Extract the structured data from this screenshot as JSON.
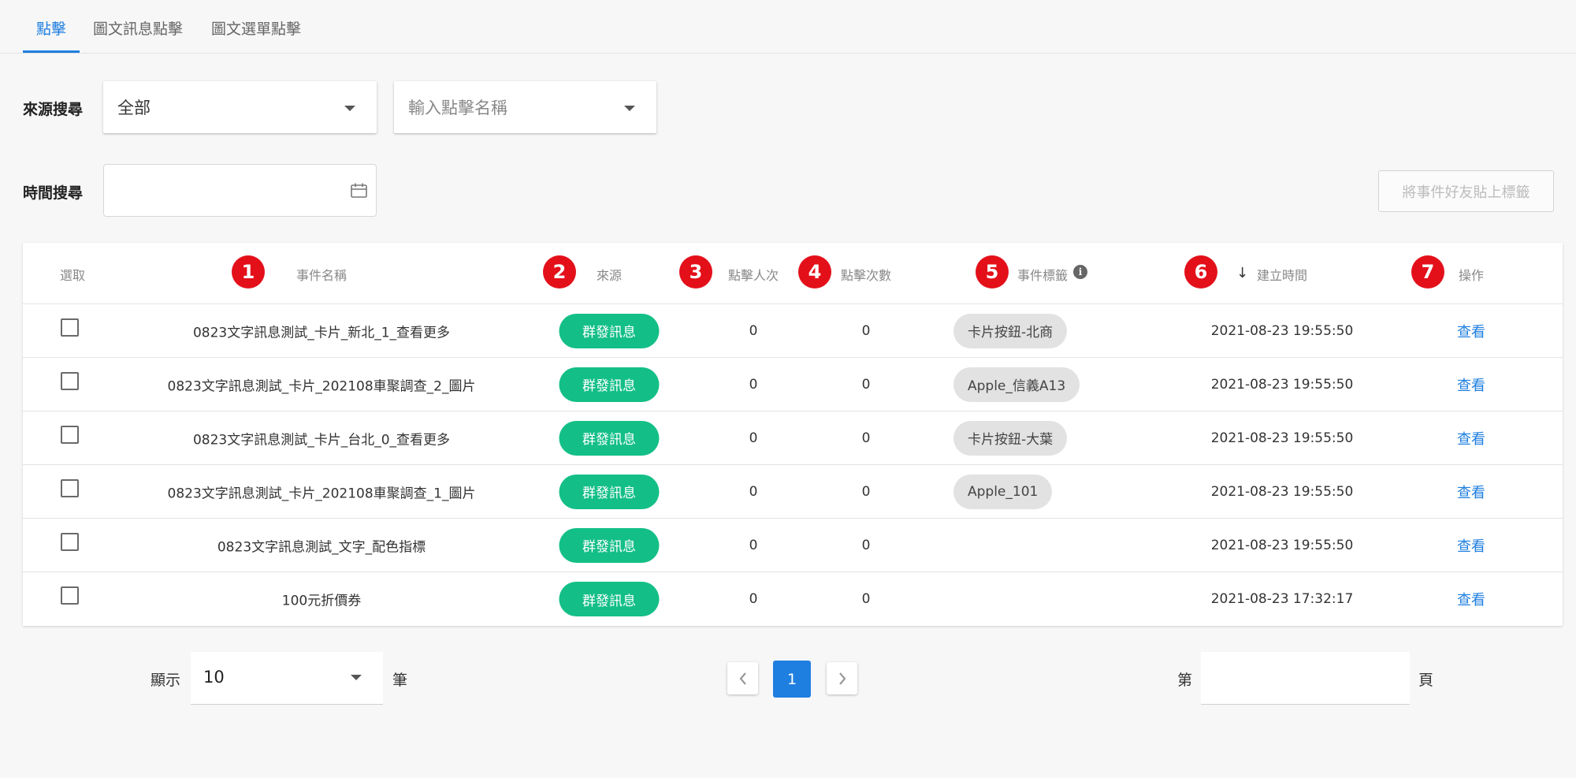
{
  "tabs": [
    {
      "label": "點擊",
      "active": true
    },
    {
      "label": "圖文訊息點擊",
      "active": false
    },
    {
      "label": "圖文選單點擊",
      "active": false
    }
  ],
  "filters": {
    "source_label": "來源搜尋",
    "source_value": "全部",
    "click_name_placeholder": "輸入點擊名稱",
    "time_label": "時間搜尋",
    "tag_button": "將事件好友貼上標籤"
  },
  "table": {
    "headers": {
      "select": "選取",
      "name": "事件名稱",
      "source": "來源",
      "click_users": "點擊人次",
      "click_count": "點擊次數",
      "event_tags": "事件標籤",
      "created": "建立時間",
      "action": "操作"
    },
    "sort_indicator": "↓",
    "annotations": [
      "1",
      "2",
      "3",
      "4",
      "5",
      "6",
      "7"
    ],
    "rows": [
      {
        "name": "0823文字訊息測試_卡片_新北_1_查看更多",
        "source": "群發訊息",
        "users": "0",
        "count": "0",
        "tag": "卡片按鈕-北商",
        "created": "2021-08-23 19:55:50",
        "action": "查看"
      },
      {
        "name": "0823文字訊息測試_卡片_202108車聚調查_2_圖片",
        "source": "群發訊息",
        "users": "0",
        "count": "0",
        "tag": "Apple_信義A13",
        "created": "2021-08-23 19:55:50",
        "action": "查看"
      },
      {
        "name": "0823文字訊息測試_卡片_台北_0_查看更多",
        "source": "群發訊息",
        "users": "0",
        "count": "0",
        "tag": "卡片按鈕-大葉",
        "created": "2021-08-23 19:55:50",
        "action": "查看"
      },
      {
        "name": "0823文字訊息測試_卡片_202108車聚調查_1_圖片",
        "source": "群發訊息",
        "users": "0",
        "count": "0",
        "tag": "Apple_101",
        "created": "2021-08-23 19:55:50",
        "action": "查看"
      },
      {
        "name": "0823文字訊息測試_文字_配色指標",
        "source": "群發訊息",
        "users": "0",
        "count": "0",
        "tag": "",
        "created": "2021-08-23 19:55:50",
        "action": "查看"
      },
      {
        "name": "100元折價券",
        "source": "群發訊息",
        "users": "0",
        "count": "0",
        "tag": "",
        "created": "2021-08-23 17:32:17",
        "action": "查看"
      }
    ]
  },
  "pagination": {
    "show_label": "顯示",
    "page_size": "10",
    "unit_label": "筆",
    "current_page": "1",
    "goto_prefix": "第",
    "goto_suffix": "頁"
  },
  "colors": {
    "accent": "#1f7fe0",
    "source_pill": "#13bf87",
    "annotation": "#e3101a",
    "tag_pill": "#e2e2e2"
  }
}
